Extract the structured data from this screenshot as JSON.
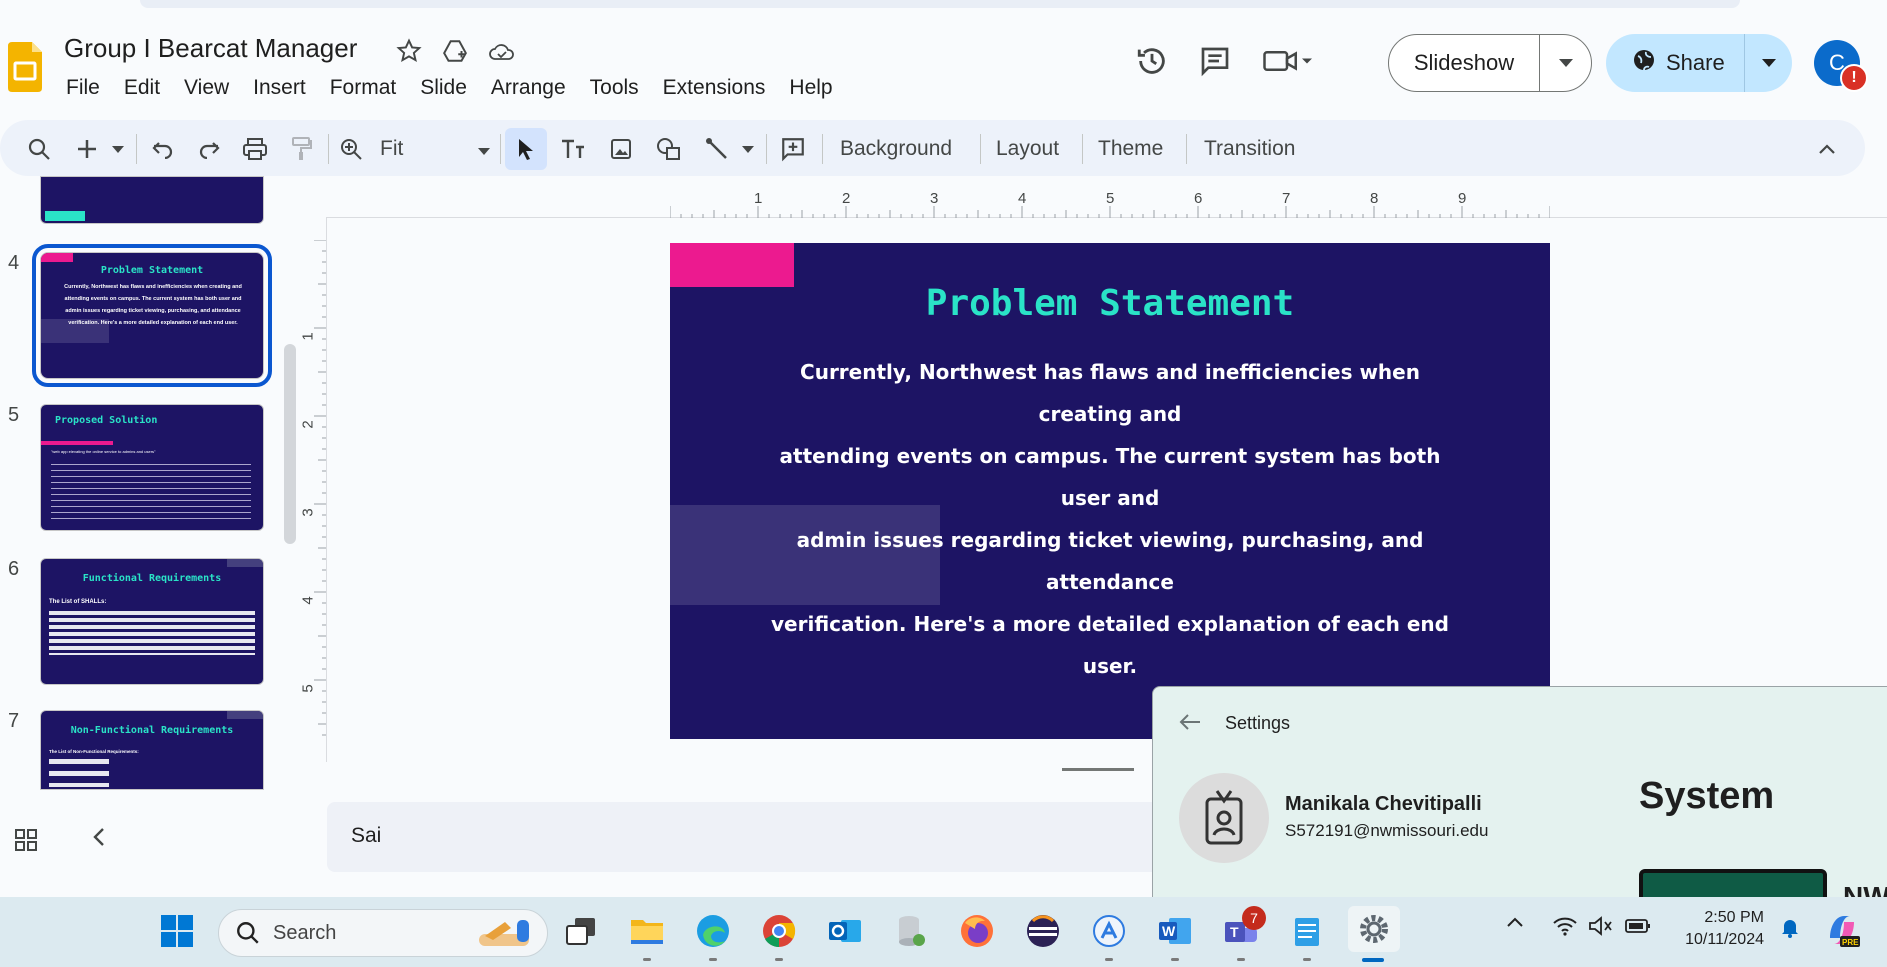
{
  "doc": {
    "title": "Group I Bearcat Manager",
    "menu": [
      "File",
      "Edit",
      "View",
      "Insert",
      "Format",
      "Slide",
      "Arrange",
      "Tools",
      "Extensions",
      "Help"
    ]
  },
  "header": {
    "slideshow_label": "Slideshow",
    "share_label": "Share",
    "avatar_letter": "C",
    "avatar_badge": "!"
  },
  "toolbar": {
    "zoom_value": "Fit",
    "background_label": "Background",
    "layout_label": "Layout",
    "theme_label": "Theme",
    "transition_label": "Transition"
  },
  "ruler": {
    "h_ticks": [
      "1",
      "2",
      "3",
      "4",
      "5",
      "6",
      "7",
      "8",
      "9"
    ],
    "v_ticks": [
      "1",
      "2",
      "3",
      "4",
      "5"
    ]
  },
  "thumbnails": [
    {
      "num": "4",
      "title": "Problem Statement",
      "body": "Currently, Northwest has flaws and inefficiencies when creating and attending events on campus. The current system has both user and admin issues regarding ticket viewing, purchasing, and attendance verification. Here's a more detailed explanation of each end user."
    },
    {
      "num": "5",
      "title": "Proposed Solution",
      "body": "\"web app elevating the online service to admins and users\""
    },
    {
      "num": "6",
      "title": "Functional Requirements",
      "body": "The List of SHALLs:"
    },
    {
      "num": "7",
      "title": "Non-Functional Requirements",
      "body": "The List of Non-Functional Requirements:"
    }
  ],
  "slide": {
    "title": "Problem Statement",
    "body_lines": [
      "Currently, Northwest has flaws and inefficiencies when creating and",
      "attending events on campus. The current system has both user and",
      "admin issues regarding ticket viewing, purchasing, and attendance",
      "verification. Here's a more detailed explanation of each end user."
    ],
    "colors": {
      "background": "#1d1464",
      "title": "#2ae3c7",
      "accent": "#ec1a8f"
    }
  },
  "notes": {
    "text": "Sai"
  },
  "settings": {
    "title": "Settings",
    "user_name": "Manikala Chevitipalli",
    "user_email": "S572191@nwmissouri.edu",
    "section": "System",
    "partial_text": "NW"
  },
  "taskbar": {
    "search_label": "Search",
    "teams_badge": "7",
    "time": "2:50 PM",
    "date": "10/11/2024"
  }
}
